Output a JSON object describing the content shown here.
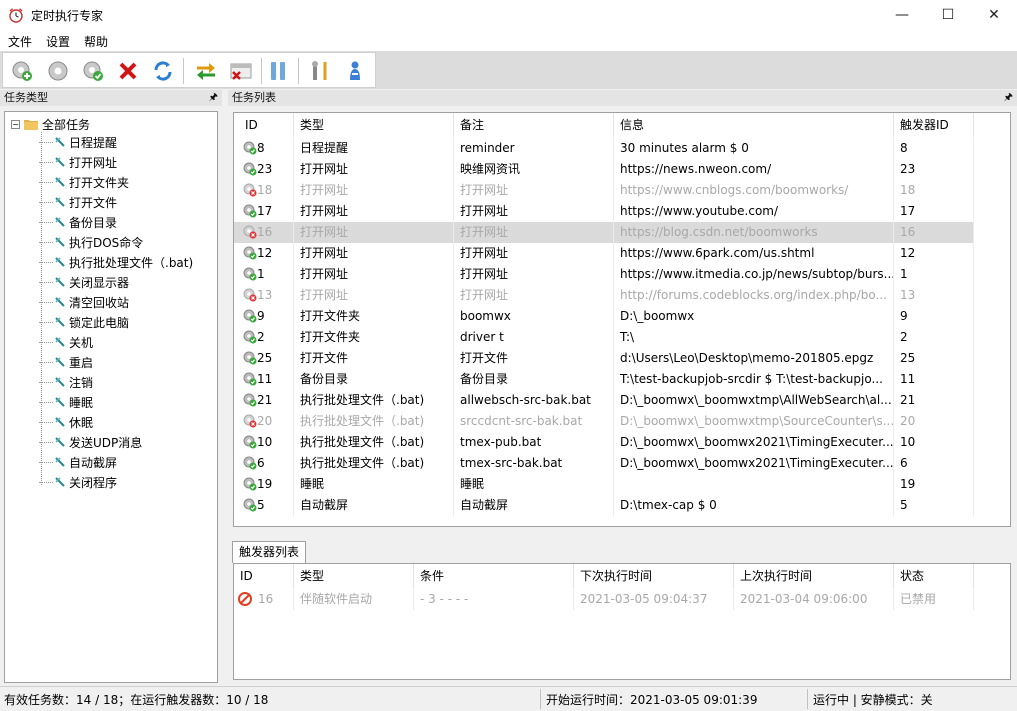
{
  "window": {
    "title": "定时执行专家",
    "minimize": "—",
    "maximize": "☐",
    "close": "✕"
  },
  "menu": [
    "文件",
    "设置",
    "帮助"
  ],
  "toolbar": {
    "icons": [
      "add-task-icon",
      "edit-task-icon",
      "enable-task-icon",
      "delete-task-icon",
      "refresh-icon",
      "swap-icon",
      "disable-icon",
      "pause-icon",
      "tools-icon",
      "user-icon"
    ]
  },
  "left_panel": {
    "header": "任务类型",
    "pin": "🖈",
    "root": "全部任务",
    "root_toggle": "−",
    "items": [
      "日程提醒",
      "打开网址",
      "打开文件夹",
      "打开文件",
      "备份目录",
      "执行DOS命令",
      "执行批处理文件（.bat)",
      "关闭显示器",
      "清空回收站",
      "锁定此电脑",
      "关机",
      "重启",
      "注销",
      "睡眠",
      "休眠",
      "发送UDP消息",
      "自动截屏",
      "关闭程序"
    ]
  },
  "task_panel": {
    "header": "任务列表",
    "pin": "🖈",
    "columns": [
      "ID",
      "类型",
      "备注",
      "信息",
      "触发器ID"
    ],
    "rows": [
      {
        "id": "8",
        "type": "日程提醒",
        "note": "reminder",
        "info": "30 minutes alarm $ 0",
        "trigger": "8",
        "status": "ok"
      },
      {
        "id": "23",
        "type": "打开网址",
        "note": "映维网资讯",
        "info": "https://news.nweon.com/",
        "trigger": "23",
        "status": "ok"
      },
      {
        "id": "18",
        "type": "打开网址",
        "note": "打开网址",
        "info": "https://www.cnblogs.com/boomworks/",
        "trigger": "18",
        "status": "off"
      },
      {
        "id": "17",
        "type": "打开网址",
        "note": "打开网址",
        "info": "https://www.youtube.com/",
        "trigger": "17",
        "status": "ok"
      },
      {
        "id": "16",
        "type": "打开网址",
        "note": "打开网址",
        "info": "https://blog.csdn.net/boomworks",
        "trigger": "16",
        "status": "off",
        "selected": true
      },
      {
        "id": "12",
        "type": "打开网址",
        "note": "打开网址",
        "info": "https://www.6park.com/us.shtml",
        "trigger": "12",
        "status": "ok"
      },
      {
        "id": "1",
        "type": "打开网址",
        "note": "打开网址",
        "info": "https://www.itmedia.co.jp/news/subtop/burs...",
        "trigger": "1",
        "status": "ok"
      },
      {
        "id": "13",
        "type": "打开网址",
        "note": "打开网址",
        "info": "http://forums.codeblocks.org/index.php/bo...",
        "trigger": "13",
        "status": "off"
      },
      {
        "id": "9",
        "type": "打开文件夹",
        "note": "boomwx",
        "info": "D:\\_boomwx",
        "trigger": "9",
        "status": "ok"
      },
      {
        "id": "2",
        "type": "打开文件夹",
        "note": "driver t",
        "info": "T:\\",
        "trigger": "2",
        "status": "ok"
      },
      {
        "id": "25",
        "type": "打开文件",
        "note": "打开文件",
        "info": "d:\\Users\\Leo\\Desktop\\memo-201805.epgz",
        "trigger": "25",
        "status": "ok"
      },
      {
        "id": "11",
        "type": "备份目录",
        "note": "备份目录",
        "info": "T:\\test-backupjob-srcdir $ T:\\test-backupjo...",
        "trigger": "11",
        "status": "ok"
      },
      {
        "id": "21",
        "type": "执行批处理文件（.bat)",
        "note": "allwebsch-src-bak.bat",
        "info": "D:\\_boomwx\\_boomwxtmp\\AllWebSearch\\al...",
        "trigger": "21",
        "status": "ok"
      },
      {
        "id": "20",
        "type": "执行批处理文件（.bat)",
        "note": "srccdcnt-src-bak.bat",
        "info": "D:\\_boomwx\\_boomwxtmp\\SourceCounter\\s...",
        "trigger": "20",
        "status": "off"
      },
      {
        "id": "10",
        "type": "执行批处理文件（.bat)",
        "note": "tmex-pub.bat",
        "info": "D:\\_boomwx\\_boomwx2021\\TimingExecuter...",
        "trigger": "10",
        "status": "ok"
      },
      {
        "id": "6",
        "type": "执行批处理文件（.bat)",
        "note": "tmex-src-bak.bat",
        "info": "D:\\_boomwx\\_boomwx2021\\TimingExecuter...",
        "trigger": "6",
        "status": "ok"
      },
      {
        "id": "19",
        "type": "睡眠",
        "note": "睡眠",
        "info": "",
        "trigger": "19",
        "status": "ok"
      },
      {
        "id": "5",
        "type": "自动截屏",
        "note": "自动截屏",
        "info": "D:\\tmex-cap $ 0",
        "trigger": "5",
        "status": "ok"
      }
    ]
  },
  "trigger_panel": {
    "tab": "触发器列表",
    "columns": [
      "ID",
      "类型",
      "条件",
      "下次执行时间",
      "上次执行时间",
      "状态"
    ],
    "rows": [
      {
        "id": "16",
        "type": "伴随软件启动",
        "condition": "- 3 - - - -",
        "next": "2021-03-05 09:04:37",
        "last": "2021-03-04 09:06:00",
        "state": "已禁用"
      }
    ]
  },
  "statusbar": {
    "left": "有效任务数：14 / 18；在运行触发器数：10 / 18",
    "middle": "开始运行时间：2021-03-05 09:01:39",
    "right": "运行中 | 安静模式：关"
  }
}
